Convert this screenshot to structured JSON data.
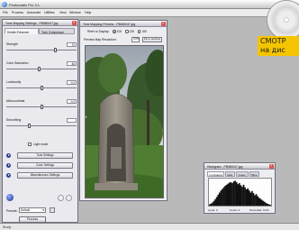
{
  "app": {
    "title": "Photomatix Pro 3.1",
    "menu": [
      "File",
      "Process",
      "Automate",
      "Utilities",
      "View",
      "Window",
      "Help"
    ],
    "status": "Ready"
  },
  "settings_panel": {
    "title": "Tone Mapping Settings - P8080047.jpg",
    "tabs": [
      "Details Enhancer",
      "Tone Compressor"
    ],
    "sliders": [
      {
        "label": "Strength",
        "value": "70",
        "fraction": 0.7
      },
      {
        "label": "Color Saturation",
        "value": "46",
        "fraction": 0.46
      },
      {
        "label": "Luminosity",
        "value": "0.0",
        "fraction": 0.5
      },
      {
        "label": "Microcontrast",
        "value": "0.0",
        "fraction": 0.5
      },
      {
        "label": "Smoothing",
        "value": "",
        "fraction": 0.32
      }
    ],
    "light_mode_label": "Light mode",
    "sections": [
      "Tone Settings",
      "Color Settings",
      "Miscellaneous Settings"
    ],
    "presets_label": "Presets:",
    "presets_value": "Default",
    "process_button": "Process"
  },
  "preview_panel": {
    "title": "Tone Mapping Preview - P8080047.jpg",
    "refer_label": "Refer to Display:",
    "refer_options": [
      "100",
      "125",
      "150"
    ],
    "refer_selected": 0,
    "size_label": "Preview Map Resolution:",
    "zoom_value": "20%",
    "fit_button": "Fit to window"
  },
  "histogram_panel": {
    "title": "Histogram - P8080047.jpg",
    "tabs": [
      "Luminance",
      "Red",
      "Green",
      "Blue"
    ],
    "active_tab": 0,
    "bars": [
      0.05,
      0.08,
      0.12,
      0.18,
      0.25,
      0.33,
      0.42,
      0.5,
      0.58,
      0.64,
      0.7,
      0.76,
      0.8,
      0.84,
      0.88,
      0.9,
      0.86,
      0.92,
      0.95,
      0.9,
      0.82,
      0.86,
      0.78,
      0.72,
      0.8,
      0.7,
      0.62,
      0.66,
      0.58,
      0.5,
      0.56,
      0.48,
      0.4,
      0.44,
      0.36,
      0.3,
      0.26,
      0.22,
      0.18,
      0.14,
      0.1,
      0.07,
      0.05,
      0.03
    ],
    "stats": {
      "level": "Level: 0",
      "count": "Count: 0",
      "percentile": "Percentile: 0.0%"
    }
  },
  "dvd_badge": {
    "line1": "СМОТР",
    "line2": "на дис"
  },
  "colors": {
    "badge_yellow": "#f4c500",
    "panel_bg": "#ececf1",
    "sky_gray": "#c8cdd2",
    "foliage_green": "#3f6a2b"
  }
}
